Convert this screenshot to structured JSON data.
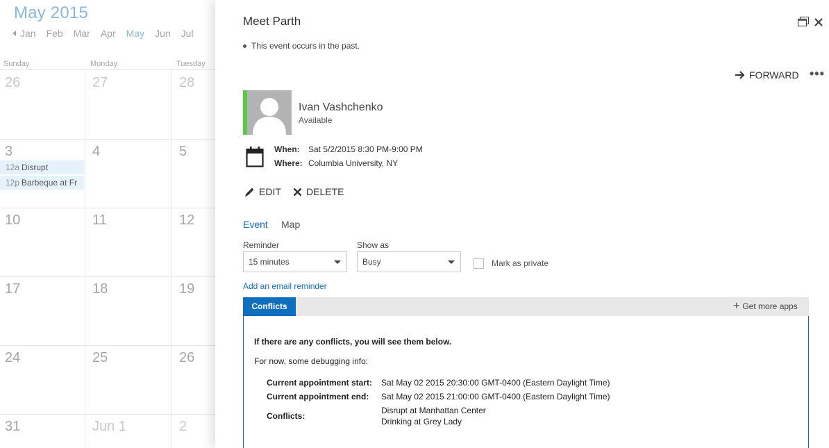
{
  "calendar": {
    "title": "May 2015",
    "months": [
      "Jan",
      "Feb",
      "Mar",
      "Apr",
      "May",
      "Jun",
      "Jul"
    ],
    "active_month": "May",
    "weekdays": [
      "Sunday",
      "Monday",
      "Tuesday"
    ],
    "weeks": [
      [
        "26",
        "27",
        "28"
      ],
      [
        "3",
        "4",
        "5"
      ],
      [
        "10",
        "11",
        "12"
      ],
      [
        "17",
        "18",
        "19"
      ],
      [
        "24",
        "25",
        "26"
      ],
      [
        "31",
        "Jun 1",
        "2"
      ]
    ],
    "events": [
      {
        "time": "12a",
        "title": "Disrupt"
      },
      {
        "time": "12p",
        "title": "Barbeque at Fr"
      }
    ]
  },
  "panel": {
    "title": "Meet Parth",
    "past_note": "This event occurs in the past.",
    "forward_label": "FORWARD",
    "more_label": "•••",
    "attendee": {
      "name": "Ivan Vashchenko",
      "status": "Available",
      "status_color": "#5cc944"
    },
    "when_label": "When:",
    "when_value": "Sat 5/2/2015 8:30 PM-9:00 PM",
    "where_label": "Where:",
    "where_value": "Columbia University, NY",
    "edit_label": "EDIT",
    "delete_label": "DELETE",
    "tabs": [
      {
        "label": "Event",
        "active": true
      },
      {
        "label": "Map",
        "active": false
      }
    ],
    "reminder": {
      "label": "Reminder",
      "value": "15 minutes"
    },
    "show_as": {
      "label": "Show as",
      "value": "Busy"
    },
    "mark_private_label": "Mark as private",
    "email_reminder_link": "Add an email reminder",
    "addin": {
      "tab_label": "Conflicts",
      "get_more_apps": "Get more apps",
      "heading": "If there are any conflicts, you will see them below.",
      "sub": "For now, some debugging info:",
      "start_label": "Current appointment start:",
      "start_value": "Sat May 02 2015 20:30:00 GMT-0400 (Eastern Daylight Time)",
      "end_label": "Current appointment end:",
      "end_value": "Sat May 02 2015 21:00:00 GMT-0400 (Eastern Daylight Time)",
      "conflicts_label": "Conflicts:",
      "conflicts": [
        "Disrupt at Manhattan Center",
        "Drinking at Grey Lady"
      ]
    }
  },
  "colors": {
    "accent": "#106ebe",
    "calendar_title": "#8ab8dc"
  }
}
